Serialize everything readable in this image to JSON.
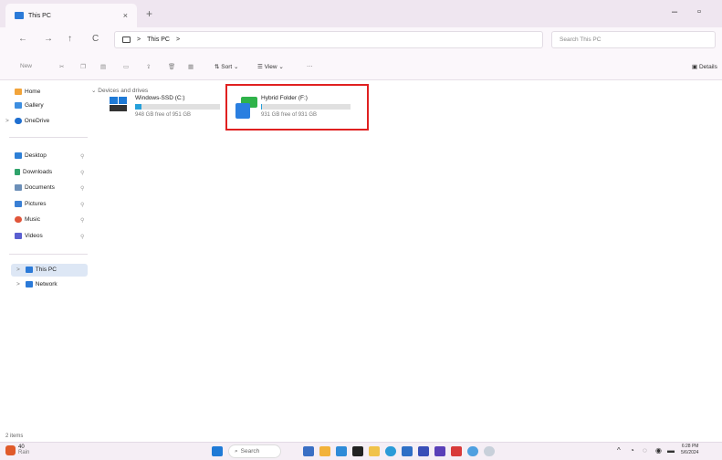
{
  "window": {
    "tab_title": "This PC",
    "tab_close": "×",
    "new_tab": "+",
    "controls": {
      "minimize": "–",
      "maximize": "▫"
    }
  },
  "addressbar": {
    "back": "←",
    "forward": "→",
    "up": "↑",
    "refresh": "C",
    "chevron": ">",
    "path": "This PC",
    "path_chevron": ">",
    "search_placeholder": "Search This PC"
  },
  "toolbar": {
    "new_label": "New",
    "sort_label": "Sort",
    "view_label": "View",
    "more_label": "···",
    "details_label": "Details"
  },
  "sidebar": {
    "home": "Home",
    "gallery": "Gallery",
    "onedrive": "OneDrive",
    "desktop": "Desktop",
    "downloads": "Downloads",
    "documents": "Documents",
    "pictures": "Pictures",
    "music": "Music",
    "videos": "Videos",
    "this_pc": "This PC",
    "network": "Network",
    "pin": "📌",
    "expand": ">"
  },
  "main": {
    "section_title": "Devices and drives",
    "drives": [
      {
        "name": "Windows-SSD (C:)",
        "free_text": "948 GB free of 951 GB",
        "used_fraction": 0.08
      },
      {
        "name": "Hybrid Folder (F:)",
        "free_text": "931 GB free of 931 GB",
        "used_fraction": 0.01
      }
    ]
  },
  "status": {
    "items": "2 items"
  },
  "taskbar": {
    "weather_temp": "40",
    "weather_desc": "Rain",
    "search_label": "Search",
    "clock_time": "6:28 PM",
    "clock_date": "5/6/2024"
  },
  "colors": {
    "accent": "#2b7ad8",
    "highlight_box": "#e02020",
    "drive_bar": "#26a0da"
  }
}
